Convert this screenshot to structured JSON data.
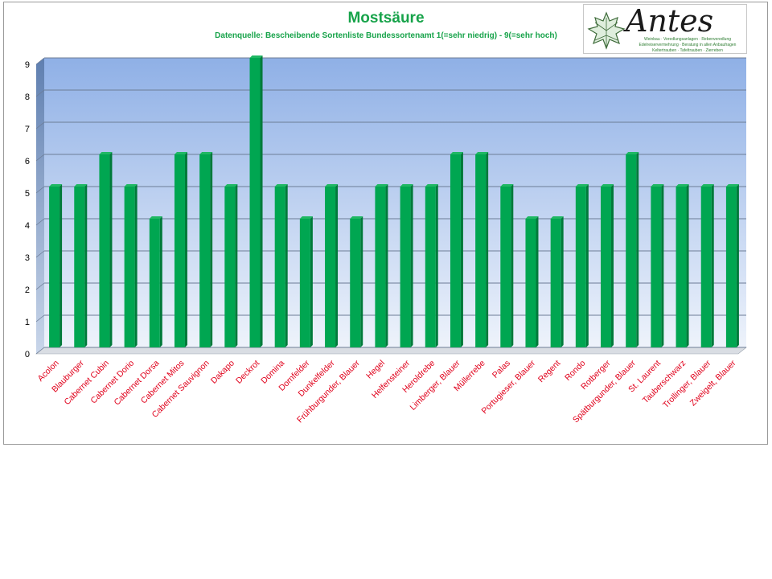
{
  "logo": {
    "brand": "Antes",
    "tagline_1": "Weinbau · Veredlungsanlagen · Rebenveredlung",
    "tagline_2": "Edelreiservermehrung · Beratung in allen Anbaufragen",
    "tagline_3": "Keltertrauben · Tafeltrauben · Zierreben"
  },
  "colors": {
    "bar": "#00a651",
    "bar_top": "#1fb863",
    "bar_side": "#007a3a",
    "category_label": "#e0001b",
    "title": "#17a34a"
  },
  "chart_data": {
    "type": "bar",
    "title": "Mostsäure",
    "subtitle": "Datenquelle: Bescheibende Sortenliste  Bundessortenamt 1(=sehr niedrig) - 9(=sehr hoch)",
    "xlabel": "",
    "ylabel": "",
    "ylim": [
      0,
      9
    ],
    "yticks": [
      0,
      1,
      2,
      3,
      4,
      5,
      6,
      7,
      8,
      9
    ],
    "grid": true,
    "categories": [
      "Acolon",
      "Blauburger",
      "Cabernet Cubin",
      "Cabernet Dorio",
      "Cabernet Dorsa",
      "Cabernet Mitos",
      "Cabernet Sauvignon",
      "Dakapo",
      "Deckrot",
      "Domina",
      "Dornfelder",
      "Dunkelfelder",
      "Frühburgunder, Blauer",
      "Hegel",
      "Helfensteiner",
      "Heroldrebe",
      "Limberger, Blauer",
      "Müllerrebe",
      "Palas",
      "Portugieser, Blauer",
      "Regent",
      "Rondo",
      "Rotberger",
      "Spätburgunder, Blauer",
      "St. Laurent",
      "Tauberschwarz",
      "Trollinger, Blauer",
      "Zweigelt, Blauer"
    ],
    "values": [
      5,
      5,
      6,
      5,
      4,
      6,
      6,
      5,
      9,
      5,
      4,
      5,
      4,
      5,
      5,
      5,
      6,
      6,
      5,
      4,
      4,
      5,
      5,
      6,
      5,
      5,
      5,
      5
    ]
  }
}
